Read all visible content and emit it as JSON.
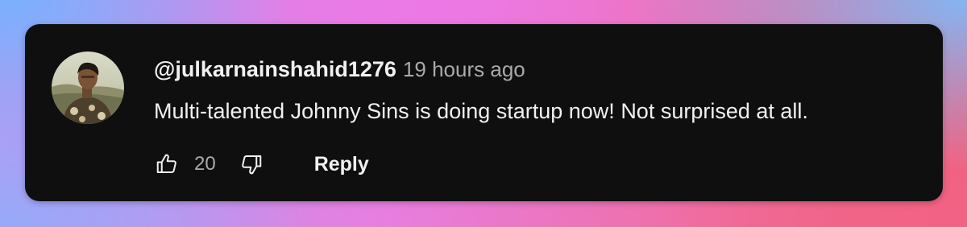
{
  "comment": {
    "username": "@julkarnainshahid1276",
    "timestamp": "19 hours ago",
    "text": "Multi-talented Johnny Sins is doing startup now! Not surprised at all.",
    "avatar_icon": "user-avatar-photo",
    "actions": {
      "like_icon": "thumbs-up-icon",
      "like_count": "20",
      "dislike_icon": "thumbs-down-icon",
      "reply_label": "Reply"
    }
  },
  "colors": {
    "card_background": "#0f0f0f",
    "primary_text": "#f1f1f1",
    "secondary_text": "#aaaaaa"
  }
}
